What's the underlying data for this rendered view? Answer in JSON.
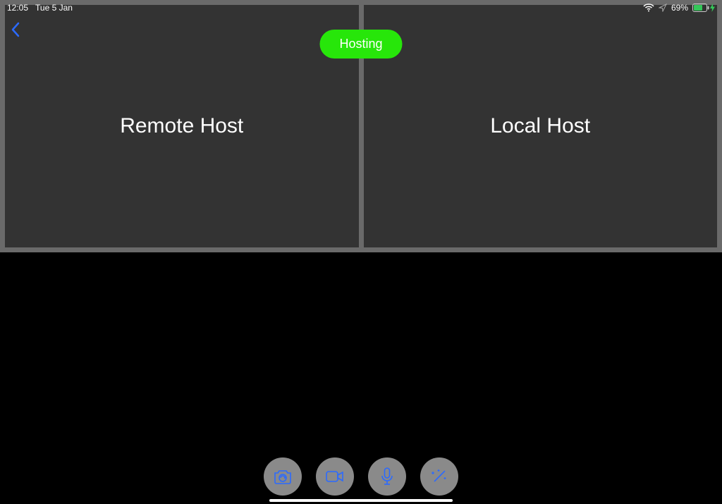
{
  "status": {
    "time": "12:05",
    "date": "Tue 5 Jan",
    "battery_pct": "69%"
  },
  "hosting_label": "Hosting",
  "tiles": {
    "left": "Remote Host",
    "right": "Local Host"
  },
  "toolbar": {
    "camera": "camera",
    "video": "video",
    "mic": "mic",
    "effects": "effects"
  }
}
